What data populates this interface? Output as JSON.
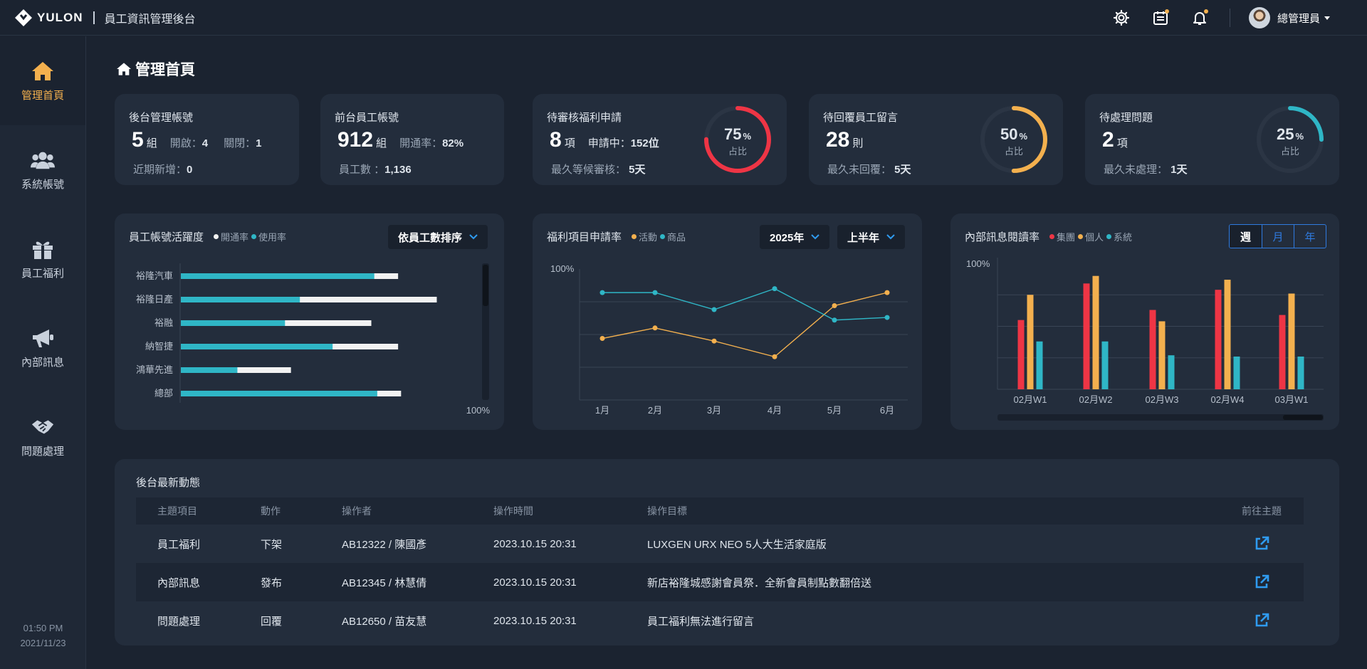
{
  "app": {
    "brand": "YULON",
    "title": "員工資訊管理後台"
  },
  "header": {
    "user_name": "總管理員",
    "icons": [
      "gear-icon",
      "calendar-icon",
      "bell-icon"
    ],
    "accent": "#f3b04e"
  },
  "sidebar": {
    "items": [
      {
        "label": "管理首頁",
        "icon": "home-icon"
      },
      {
        "label": "系統帳號",
        "icon": "users-icon"
      },
      {
        "label": "員工福利",
        "icon": "gift-icon"
      },
      {
        "label": "內部訊息",
        "icon": "megaphone-icon"
      },
      {
        "label": "問題處理",
        "icon": "handshake-icon"
      }
    ],
    "time": "01:50 PM",
    "date": "2021/11/23"
  },
  "page": {
    "title": "管理首頁"
  },
  "stats": [
    {
      "title": "後台管理帳號",
      "value": "5",
      "unit": "組",
      "inline": [
        [
          "開啟：",
          "4"
        ],
        [
          "關閉：",
          "1"
        ]
      ],
      "sub_label": "近期新增：",
      "sub_value": "0"
    },
    {
      "title": "前台員工帳號",
      "value": "912",
      "unit": "組",
      "inline": [
        [
          "開通率：",
          "82%"
        ]
      ],
      "sub_label": "員工數 ：",
      "sub_value": "1,136"
    },
    {
      "title": "待審核福利申請",
      "value": "8",
      "unit": "項",
      "inline": [
        [
          "申請中：",
          "152位"
        ]
      ],
      "sub_label": "最久等候審核： ",
      "sub_value": "5天",
      "ring_pct": "75",
      "ring_caption": "占比",
      "ring_color": "#ee3545",
      "ring_fraction": 0.75
    },
    {
      "title": "待回覆員工留言",
      "value": "28",
      "unit": "則",
      "inline": [],
      "sub_label": "最久未回覆： ",
      "sub_value": "5天",
      "ring_pct": "50",
      "ring_caption": "占比",
      "ring_color": "#f3b04e",
      "ring_fraction": 0.5
    },
    {
      "title": "待處理問題",
      "value": "2",
      "unit": "項",
      "inline": [],
      "sub_label": "最久未處理： ",
      "sub_value": "1天",
      "ring_pct": "25",
      "ring_caption": "占比",
      "ring_color": "#2fb6c6",
      "ring_fraction": 0.25
    }
  ],
  "ring_unit": "%",
  "panels": {
    "activity": {
      "title": "員工帳號活躍度",
      "legend": [
        "開通率",
        "使用率"
      ],
      "sort_label": "依員工數排序"
    },
    "welfare": {
      "title": "福利項目申請率",
      "legend": [
        "活動",
        "商品"
      ],
      "year": "2025年",
      "half": "上半年"
    },
    "reading": {
      "title": "內部訊息閱讀率",
      "legend": [
        "集團",
        "個人",
        "系統"
      ],
      "tabs": [
        "週",
        "月",
        "年"
      ],
      "active_tab": "週"
    }
  },
  "chart_data": [
    {
      "type": "bar",
      "orientation": "horizontal",
      "categories": [
        "裕隆汽車",
        "裕隆日產",
        "裕融",
        "納智捷",
        "鴻華先進",
        "總部"
      ],
      "series": [
        {
          "name": "開通率",
          "color": "#f2f2f2",
          "values": [
            73,
            86,
            64,
            73,
            37,
            74
          ]
        },
        {
          "name": "使用率",
          "color": "#2fb6c6",
          "values": [
            65,
            40,
            35,
            51,
            19,
            66
          ]
        }
      ],
      "xlim": [
        0,
        100
      ],
      "xtick_label": "100%"
    },
    {
      "type": "line",
      "x": [
        "1月",
        "2月",
        "3月",
        "4月",
        "5月",
        "6月"
      ],
      "series": [
        {
          "name": "活動",
          "color": "#f3b04e",
          "values": [
            47,
            55,
            45,
            33,
            72,
            82
          ]
        },
        {
          "name": "商品",
          "color": "#2fb6c6",
          "values": [
            82,
            82,
            69,
            85,
            61,
            63
          ]
        }
      ],
      "ylim": [
        0,
        100
      ],
      "ytick_label": "100%"
    },
    {
      "type": "bar",
      "categories": [
        "02月W1",
        "02月W2",
        "02月W3",
        "02月W4",
        "03月W1"
      ],
      "series": [
        {
          "name": "集團",
          "color": "#ee3545",
          "values": [
            55,
            84,
            63,
            79,
            59
          ]
        },
        {
          "name": "個人",
          "color": "#f3b04e",
          "values": [
            75,
            90,
            54,
            87,
            76
          ]
        },
        {
          "name": "系統",
          "color": "#2fb6c6",
          "values": [
            38,
            38,
            27,
            26,
            26
          ]
        }
      ],
      "ylim": [
        0,
        100
      ],
      "ytick_label": "100%"
    }
  ],
  "activity_table": {
    "title": "後台最新動態",
    "headers": [
      "主題項目",
      "動作",
      "操作者",
      "操作時間",
      "操作目標",
      "前往主題"
    ],
    "rows": [
      {
        "topic": "員工福利",
        "action": "下架",
        "operator": "AB12322 / 陳國彥",
        "time": "2023.10.15 20:31",
        "target": "LUXGEN URX NEO 5人大生活家庭版"
      },
      {
        "topic": "內部訊息",
        "action": "發布",
        "operator": "AB12345 / 林慧倩",
        "time": "2023.10.15 20:31",
        "target": "新店裕隆城感謝會員祭．全新會員制點數翻倍送"
      },
      {
        "topic": "問題處理",
        "action": "回覆",
        "operator": "AB12650 / 苗友慧",
        "time": "2023.10.15 20:31",
        "target": "員工福利無法進行留言"
      }
    ]
  }
}
